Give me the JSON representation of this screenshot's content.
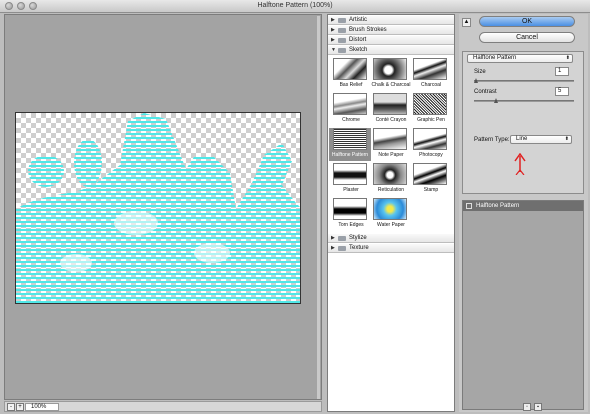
{
  "window": {
    "title": "Halftone Pattern (100%)"
  },
  "status": {
    "zoom_value": "100%",
    "zoom_out": "-",
    "zoom_in": "+"
  },
  "gallery": {
    "categories": [
      {
        "label": "Artistic",
        "expanded": false
      },
      {
        "label": "Brush Strokes",
        "expanded": false
      },
      {
        "label": "Distort",
        "expanded": false
      },
      {
        "label": "Sketch",
        "expanded": true
      },
      {
        "label": "Stylize",
        "expanded": false
      },
      {
        "label": "Texture",
        "expanded": false
      }
    ],
    "sketch_filters": [
      "Bas Relief",
      "Chalk & Charcoal",
      "Charcoal",
      "Chrome",
      "Conté Crayon",
      "Graphic Pen",
      "Halftone Pattern",
      "Note Paper",
      "Photocopy",
      "Plaster",
      "Reticulation",
      "Stamp",
      "Torn Edges",
      "Water Paper"
    ],
    "selected": "Halftone Pattern"
  },
  "dialog": {
    "ok_label": "OK",
    "cancel_label": "Cancel",
    "collapse_glyph": "▲",
    "filter_select": "Halftone Pattern",
    "size_label": "Size",
    "size_value": "1",
    "size_slider_fraction": 0.0,
    "contrast_label": "Contrast",
    "contrast_value": "5",
    "contrast_slider_fraction": 0.2,
    "pattern_type_label": "Pattern Type:",
    "pattern_type_value": "Line",
    "select_arrow_glyph": "⬍"
  },
  "layers": {
    "items": [
      {
        "label": "Halftone Pattern"
      }
    ]
  },
  "colors": {
    "halftone": "#4fe8e8",
    "ok_button": "#5a9ae6",
    "annotation_arrow": "#e02020"
  }
}
